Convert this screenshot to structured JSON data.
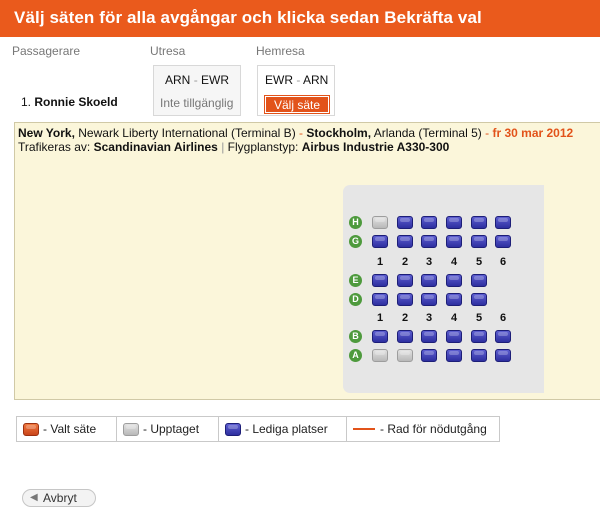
{
  "header": {
    "title": "Välj säten för alla avgångar och klicka sedan Bekräfta val"
  },
  "columns": {
    "passengers": "Passagerare",
    "outbound": "Utresa",
    "return": "Hemresa"
  },
  "passenger": {
    "index": "1.",
    "name": "Ronnie Skoeld"
  },
  "outbound": {
    "from": "ARN",
    "to": "EWR",
    "status": "Inte tillgänglig"
  },
  "return_flight": {
    "from": "EWR",
    "to": "ARN",
    "button": "Välj säte"
  },
  "flight_info": {
    "origin_city": "New York,",
    "origin_airport": "Newark Liberty International (Terminal B)",
    "arrow": "-",
    "dest_city": "Stockholm,",
    "dest_airport": "Arlanda (Terminal 5)",
    "date_sep": "-",
    "date": "fr 30 mar 2012",
    "operated_label": "Trafikeras av:",
    "operator": "Scandinavian Airlines",
    "pipe": "|",
    "aircraft_label": "Flygplanstyp:",
    "aircraft": "Airbus Industrie A330-300"
  },
  "seat_map": {
    "groups": [
      {
        "rows": [
          {
            "letter": "H",
            "seats": [
              "occupied",
              "free",
              "free",
              "free",
              "free",
              "free"
            ]
          },
          {
            "letter": "G",
            "seats": [
              "free",
              "free",
              "free",
              "free",
              "free",
              "free"
            ]
          }
        ],
        "numbers": [
          "1",
          "2",
          "3",
          "4",
          "5",
          "6"
        ]
      },
      {
        "rows": [
          {
            "letter": "E",
            "seats": [
              "free",
              "free",
              "free",
              "free",
              "free"
            ]
          },
          {
            "letter": "D",
            "seats": [
              "free",
              "free",
              "free",
              "free",
              "free"
            ]
          }
        ],
        "numbers": [
          "1",
          "2",
          "3",
          "4",
          "5",
          "6"
        ]
      },
      {
        "rows": [
          {
            "letter": "B",
            "seats": [
              "free",
              "free",
              "free",
              "free",
              "free",
              "free"
            ]
          },
          {
            "letter": "A",
            "seats": [
              "occupied",
              "occupied",
              "free",
              "free",
              "free",
              "free"
            ]
          }
        ],
        "numbers": []
      }
    ]
  },
  "legend": {
    "selected": "- Valt säte",
    "occupied": "- Upptaget",
    "free": "- Lediga platser",
    "exit_row": "- Rad för nödutgång"
  },
  "footer": {
    "back": "Avbryt"
  },
  "colors": {
    "brand": "#ea5a1c",
    "panel": "#fbf6da",
    "row_badge": "#4e9a3d",
    "free_seat": "#3a3bb0"
  }
}
